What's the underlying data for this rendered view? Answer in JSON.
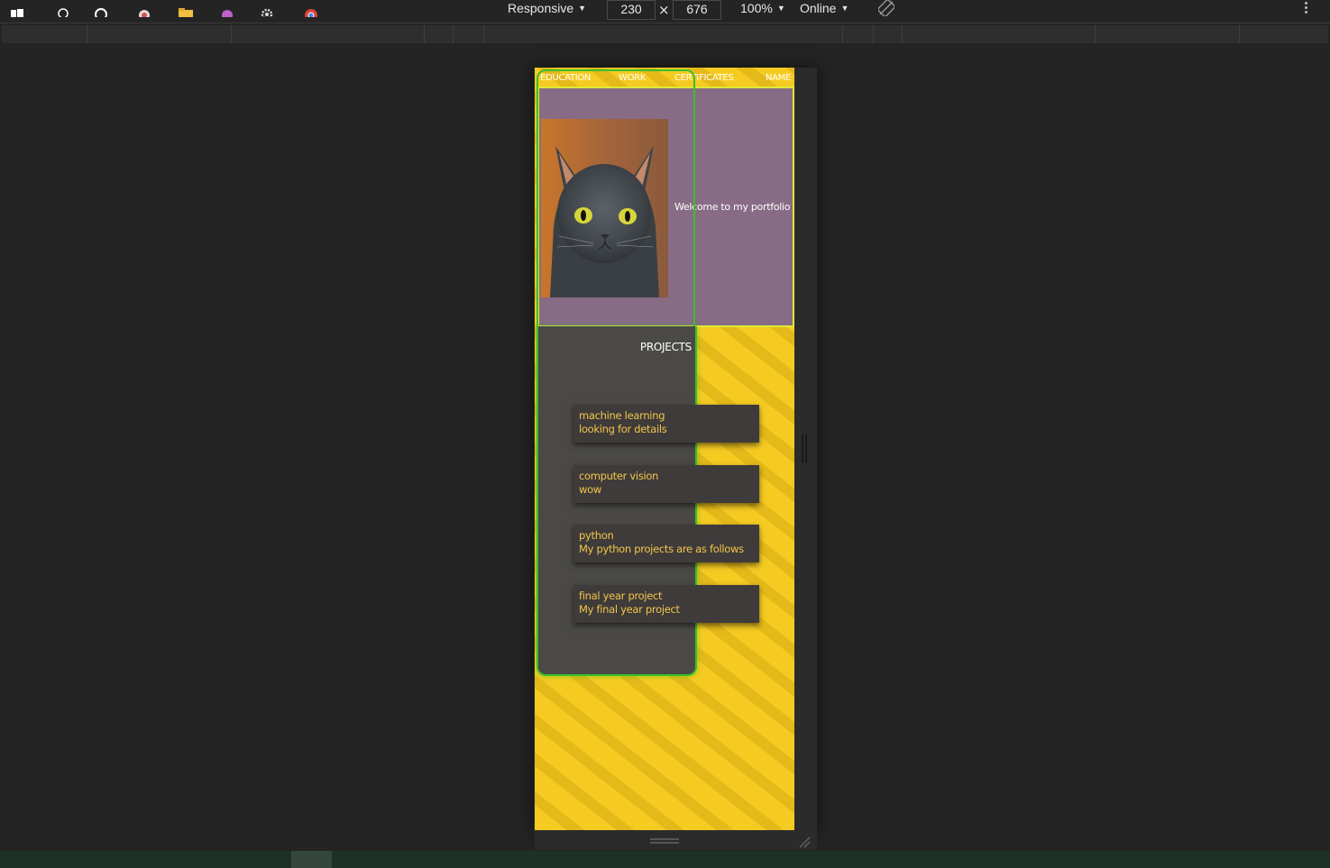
{
  "devtools": {
    "device": "Responsive",
    "width": "230",
    "height": "676",
    "times": "×",
    "zoom": "100%",
    "network": "Online",
    "caret": "▼"
  },
  "page": {
    "nav": {
      "education": "EDUCATION",
      "work": "WORK",
      "certificates": "CERTIFICATES",
      "name": "NAME"
    },
    "hero": {
      "text": "Welcome to my portfolio"
    },
    "projects": {
      "title": "PROJECTS",
      "items": [
        {
          "title": "machine learning",
          "desc": "looking for details"
        },
        {
          "title": "computer vision",
          "desc": "wow"
        },
        {
          "title": "python",
          "desc": "My python projects are as follows"
        },
        {
          "title": "final year project",
          "desc": "My final year project"
        }
      ]
    }
  },
  "colors": {
    "page_bg": "#f5cb22",
    "hero_bg": "#886b85",
    "projects_bg": "#4a4946",
    "outline_green": "#3bbf2a",
    "card_text": "#f2c64a"
  }
}
